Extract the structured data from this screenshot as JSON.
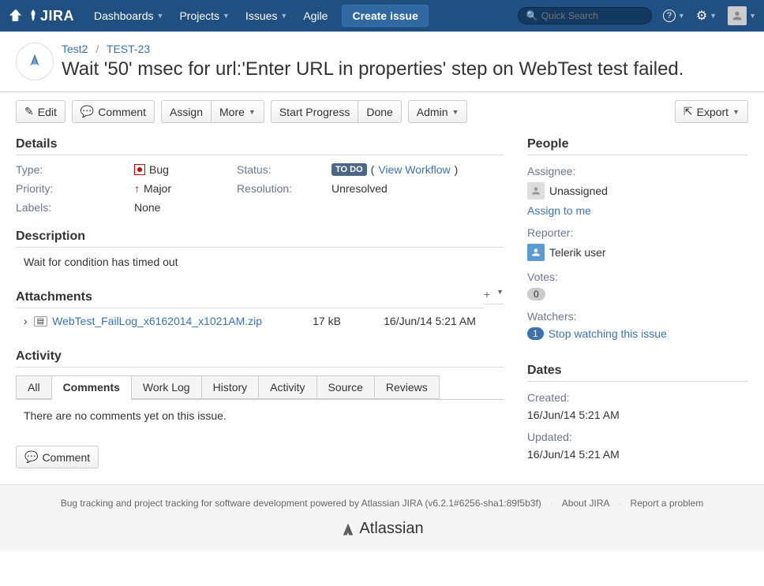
{
  "nav": {
    "logo": "JIRA",
    "items": [
      "Dashboards",
      "Projects",
      "Issues",
      "Agile"
    ],
    "create": "Create issue",
    "search_placeholder": "Quick Search"
  },
  "breadcrumb": {
    "project": "Test2",
    "key": "TEST-23"
  },
  "title": "Wait '50' msec for url:'Enter URL in properties' step on WebTest test failed.",
  "toolbar": {
    "edit": "Edit",
    "comment": "Comment",
    "assign": "Assign",
    "more": "More",
    "start": "Start Progress",
    "done": "Done",
    "admin": "Admin",
    "export": "Export"
  },
  "sections": {
    "details": "Details",
    "description": "Description",
    "attachments": "Attachments",
    "activity": "Activity",
    "people": "People",
    "dates": "Dates"
  },
  "details": {
    "type_label": "Type:",
    "type_value": "Bug",
    "status_label": "Status:",
    "status_value": "TO DO",
    "view_workflow": "View Workflow",
    "priority_label": "Priority:",
    "priority_value": "Major",
    "resolution_label": "Resolution:",
    "resolution_value": "Unresolved",
    "labels_label": "Labels:",
    "labels_value": "None"
  },
  "description": "Wait for condition has timed out",
  "attachment": {
    "name": "WebTest_FailLog_x6162014_x1021AM.zip",
    "size": "17 kB",
    "date": "16/Jun/14 5:21 AM"
  },
  "tabs": [
    "All",
    "Comments",
    "Work Log",
    "History",
    "Activity",
    "Source",
    "Reviews"
  ],
  "active_tab": "Comments",
  "no_comments": "There are no comments yet on this issue.",
  "comment_btn": "Comment",
  "people": {
    "assignee_label": "Assignee:",
    "assignee_value": "Unassigned",
    "assign_to_me": "Assign to me",
    "reporter_label": "Reporter:",
    "reporter_value": "Telerik user",
    "votes_label": "Votes:",
    "votes_count": "0",
    "watchers_label": "Watchers:",
    "watchers_count": "1",
    "stop_watching": "Stop watching this issue"
  },
  "dates": {
    "created_label": "Created:",
    "created_value": "16/Jun/14 5:21 AM",
    "updated_label": "Updated:",
    "updated_value": "16/Jun/14 5:21 AM"
  },
  "footer": {
    "text1": "Bug tracking and project tracking for software development powered by ",
    "jira_link": "Atlassian JIRA",
    "version": " (v6.2.1#6256-sha1:89f5b3f)",
    "about": "About JIRA",
    "report": "Report a problem",
    "atlassian": "Atlassian"
  }
}
